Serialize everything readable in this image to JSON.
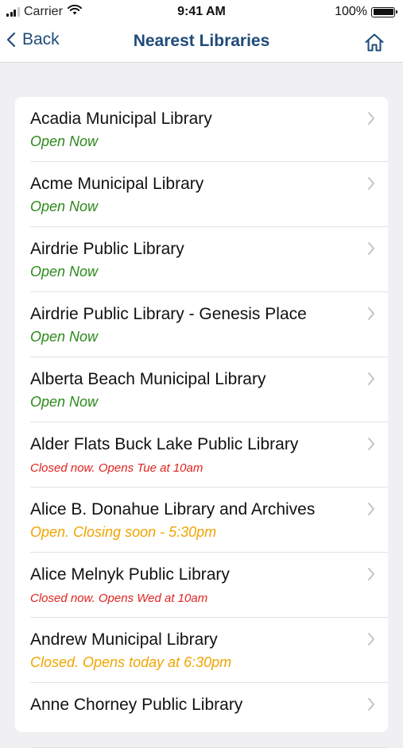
{
  "status_bar": {
    "carrier": "Carrier",
    "time": "9:41 AM",
    "battery": "100%"
  },
  "nav": {
    "back_label": "Back",
    "title": "Nearest Libraries",
    "home_icon": "home-icon"
  },
  "colors": {
    "nav_text": "#1f4b7a",
    "open": "#2d8a1c",
    "closed": "#e0231e",
    "closing_soon": "#f0a400",
    "background": "#f0f0f2"
  },
  "libraries": [
    {
      "name": "Acadia Municipal Library",
      "status": "Open Now"
    },
    {
      "name": "Acme Municipal Library",
      "status": "Open Now"
    },
    {
      "name": "Airdrie Public Library",
      "status": "Open Now"
    },
    {
      "name": "Airdrie Public Library - Genesis Place",
      "status": "Open Now"
    },
    {
      "name": "Alberta Beach Municipal Library",
      "status": "Open Now"
    },
    {
      "name": "Alder Flats Buck Lake Public Library",
      "status": "Closed now. Opens Tue at 10am"
    },
    {
      "name": "Alice B. Donahue Library and Archives",
      "status": "Open. Closing soon - 5:30pm"
    },
    {
      "name": "Alice Melnyk Public Library",
      "status": "Closed now. Opens Wed at 10am"
    },
    {
      "name": "Andrew Municipal Library",
      "status": "Closed. Opens today at 6:30pm"
    },
    {
      "name": "Anne Chorney Public Library",
      "status": ""
    }
  ]
}
